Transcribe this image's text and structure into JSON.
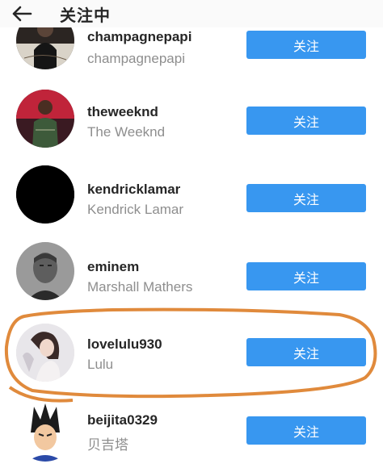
{
  "header": {
    "title": "关注中",
    "back_icon": "arrow-left-icon"
  },
  "accent_color": "#3897f0",
  "annotation_color": "#e08a3c",
  "rows": [
    {
      "username": "champagnepapi",
      "full_name": "champagnepapi",
      "button": "关注"
    },
    {
      "username": "theweeknd",
      "full_name": "The Weeknd",
      "button": "关注"
    },
    {
      "username": "kendricklamar",
      "full_name": "Kendrick Lamar",
      "button": "关注"
    },
    {
      "username": "eminem",
      "full_name": "Marshall Mathers",
      "button": "关注"
    },
    {
      "username": "lovelulu930",
      "full_name": "Lulu",
      "button": "关注"
    },
    {
      "username": "beijita0329",
      "full_name": "贝吉塔",
      "button": "关注"
    }
  ]
}
